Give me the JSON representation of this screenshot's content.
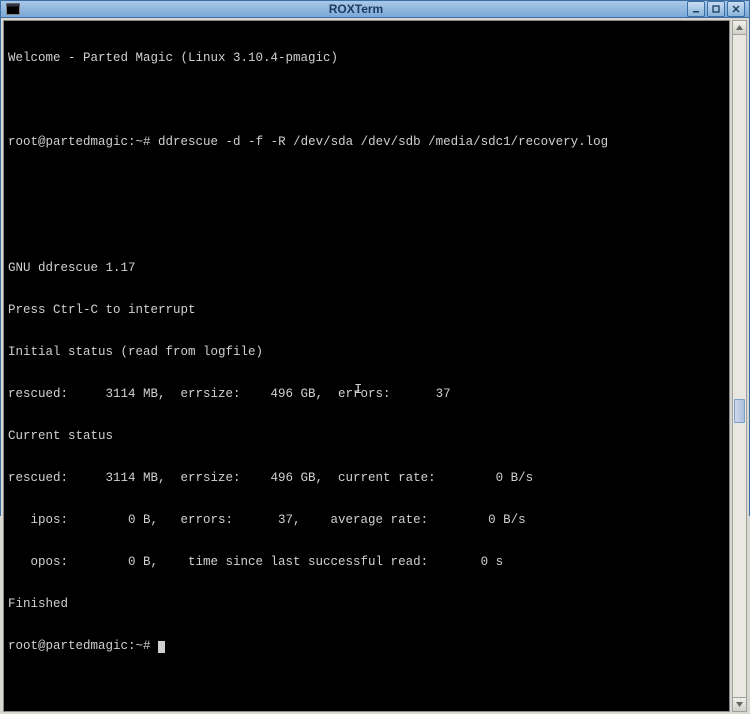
{
  "window": {
    "title": "ROXTerm"
  },
  "terminal": {
    "welcome": "Welcome - Parted Magic (Linux 3.10.4-pmagic)",
    "prompt": "root@partedmagic:~#",
    "command": "ddrescue -d -f -R /dev/sda /dev/sdb /media/sdc1/recovery.log",
    "lines": {
      "blank": "",
      "prog_name": "GNU ddrescue 1.17",
      "interrupt": "Press Ctrl-C to interrupt",
      "init_status": "Initial status (read from logfile)",
      "init_rescued": "rescued:     3114 MB,  errsize:    496 GB,  errors:      37",
      "cur_status": "Current status",
      "cur_rescued": "rescued:     3114 MB,  errsize:    496 GB,  current rate:        0 B/s",
      "ipos": "   ipos:        0 B,   errors:      37,    average rate:        0 B/s",
      "opos": "   opos:        0 B,    time since last successful read:       0 s",
      "finished": "Finished"
    }
  }
}
